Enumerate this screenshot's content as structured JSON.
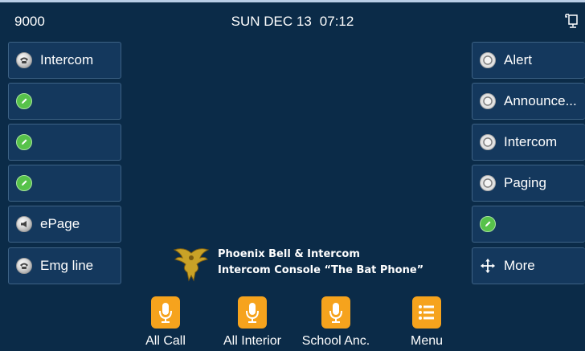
{
  "status_bar": {
    "extension": "9000",
    "date": "SUN DEC 13",
    "time": "07:12"
  },
  "left_keys": [
    {
      "label": "Intercom",
      "icon": "phone-icon"
    },
    {
      "label": "",
      "icon": "edit-icon"
    },
    {
      "label": "",
      "icon": "edit-icon"
    },
    {
      "label": "",
      "icon": "edit-icon"
    },
    {
      "label": "ePage",
      "icon": "megaphone-icon"
    },
    {
      "label": "Emg line",
      "icon": "phone-icon"
    }
  ],
  "right_keys": [
    {
      "label": "Alert",
      "icon": "ring-icon"
    },
    {
      "label": "Announce...",
      "icon": "ring-icon"
    },
    {
      "label": "Intercom",
      "icon": "ring-icon"
    },
    {
      "label": "Paging",
      "icon": "ring-icon"
    },
    {
      "label": "",
      "icon": "edit-icon"
    },
    {
      "label": "More",
      "icon": "move-arrows-icon"
    }
  ],
  "branding": {
    "line1": "Phoenix Bell & Intercom",
    "line2": "Intercom Console “The Bat Phone”"
  },
  "softkeys": [
    {
      "label": "All Call",
      "icon": "microphone-icon"
    },
    {
      "label": "All Interior",
      "icon": "microphone-icon"
    },
    {
      "label": "School Anc.",
      "icon": "microphone-icon"
    },
    {
      "label": "Menu",
      "icon": "menu-list-icon"
    }
  ],
  "colors": {
    "background": "#0b2b48",
    "key_bg": "#14385d",
    "accent_orange": "#f6a31d",
    "status_green": "#57c24a"
  }
}
